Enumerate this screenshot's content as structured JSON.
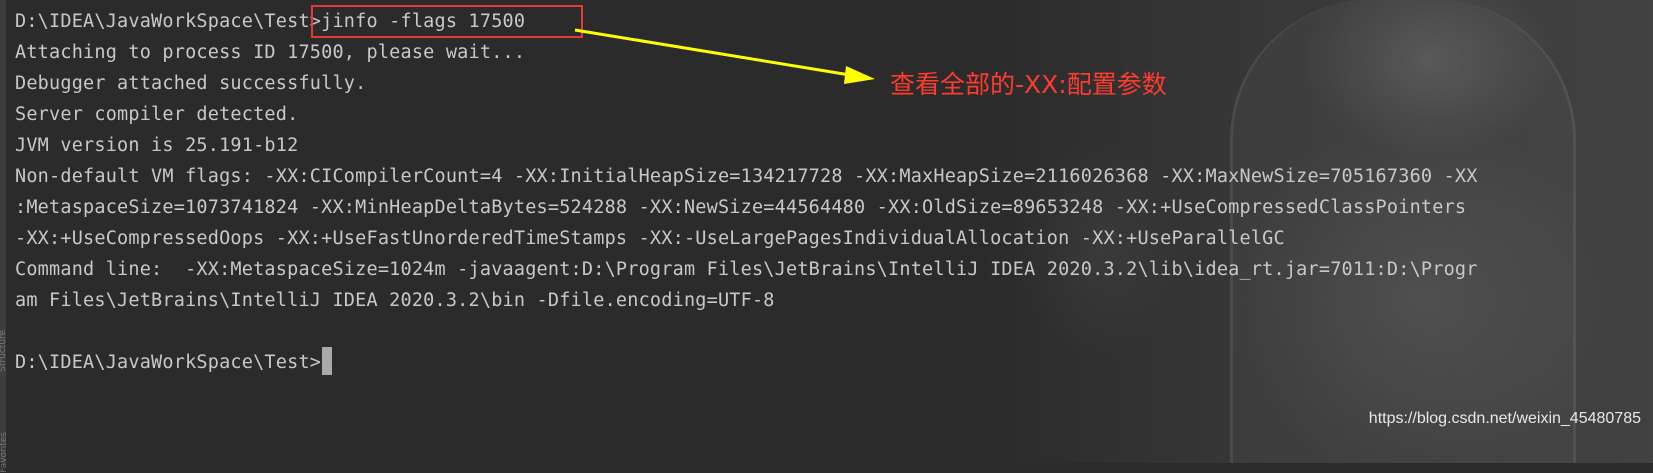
{
  "terminal": {
    "lines": [
      "D:\\IDEA\\JavaWorkSpace\\Test>jinfo -flags 17500",
      "Attaching to process ID 17500, please wait...",
      "Debugger attached successfully.",
      "Server compiler detected.",
      "JVM version is 25.191-b12",
      "Non-default VM flags: -XX:CICompilerCount=4 -XX:InitialHeapSize=134217728 -XX:MaxHeapSize=2116026368 -XX:MaxNewSize=705167360 -XX",
      ":MetaspaceSize=1073741824 -XX:MinHeapDeltaBytes=524288 -XX:NewSize=44564480 -XX:OldSize=89653248 -XX:+UseCompressedClassPointers",
      "-XX:+UseCompressedOops -XX:+UseFastUnorderedTimeStamps -XX:-UseLargePagesIndividualAllocation -XX:+UseParallelGC",
      "Command line:  -XX:MetaspaceSize=1024m -javaagent:D:\\Program Files\\JetBrains\\IntelliJ IDEA 2020.3.2\\lib\\idea_rt.jar=7011:D:\\Progr",
      "am Files\\JetBrains\\IntelliJ IDEA 2020.3.2\\bin -Dfile.encoding=UTF-8",
      ""
    ],
    "prompt": "D:\\IDEA\\JavaWorkSpace\\Test>"
  },
  "annotation": {
    "text": "查看全部的-XX:配置参数",
    "color": "#ff3b30"
  },
  "watermark": "https://blog.csdn.net/weixin_45480785",
  "side_strip": {
    "label_1": "Structure",
    "label_2": "Favorites"
  },
  "colors": {
    "background": "#2b2b2b",
    "text": "#c8c8c8",
    "highlight_box": "#e53935",
    "arrow": "#ffff00"
  }
}
